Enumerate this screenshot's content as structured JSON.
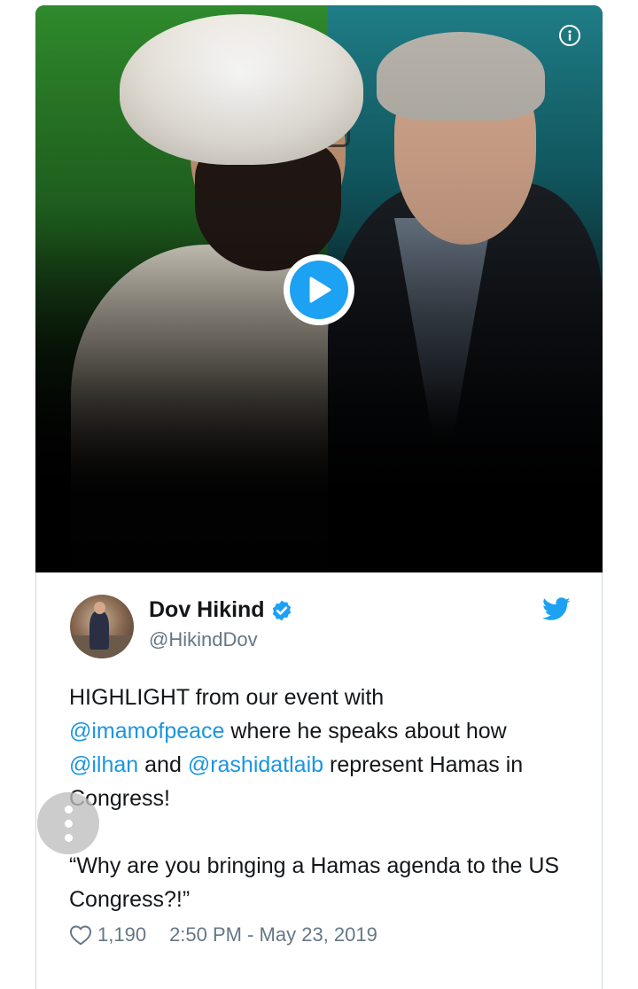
{
  "media": {
    "info_icon": "info-icon",
    "play_icon": "play-icon",
    "accent_color": "#1da1f2"
  },
  "tweet": {
    "author_name": "Dov Hikind",
    "handle": "@HikindDov",
    "verified_icon": "verified-badge-icon",
    "brand_icon": "twitter-bird-icon",
    "text": {
      "p1_prefix": "HIGHLIGHT from our event with",
      "mention_1": "@imamofpeace",
      "p1_mid_1": " where he speaks about how",
      "mention_2": "@ilhan",
      "p1_mid_2": " and ",
      "mention_3": "@rashidatlaib",
      "p1_suffix": " represent Hamas in Congress!",
      "quote": "“Why are you bringing a Hamas agenda to the US Congress?!”"
    },
    "likes": "1,190",
    "like_icon": "heart-icon",
    "timestamp": "2:50 PM - May 23, 2019"
  },
  "floating_button": {
    "icon": "more-vertical-icon"
  }
}
